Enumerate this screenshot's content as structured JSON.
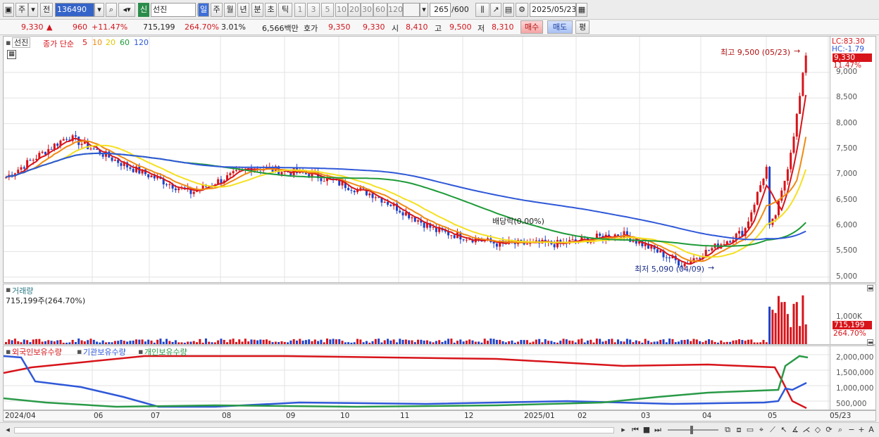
{
  "toolbar": {
    "mode_main": "주",
    "mode_prev": "전",
    "stock_code": "136490",
    "stock_badge": "신",
    "stock_name": "선진",
    "period_tabs": [
      "일",
      "주",
      "월",
      "년",
      "분",
      "초",
      "틱"
    ],
    "period_active": "일",
    "interval_buttons": [
      "1",
      "3",
      "5",
      "10",
      "20",
      "30",
      "60",
      "120"
    ],
    "count_display": "265",
    "count_total": "/600",
    "date": "2025/05/23"
  },
  "quote": {
    "price": "9,330",
    "change_arrow": "▲",
    "change": "960",
    "change_pct": "+11.47%",
    "volume": "715,199",
    "volume_ratio": "264.70%",
    "turnover": "3.01%",
    "amount": "6,566백만",
    "bid_label": "호가",
    "ask": "9,350",
    "bid": "9,330",
    "open_label": "시",
    "open": "8,410",
    "high_label": "고",
    "high": "9,500",
    "low_label": "저",
    "low": "8,310",
    "buy_button": "매수",
    "sell_button": "매도",
    "eval_button": "평"
  },
  "price_panel": {
    "title": "선진",
    "legend_title": "종가 단순",
    "ma_labels": [
      "5",
      "10",
      "20",
      "60",
      "120"
    ],
    "ma_colors": [
      "#d7141a",
      "#f08a12",
      "#f5e020",
      "#1e9a38",
      "#2f58d8"
    ],
    "annotation_high": "최고 9,500 (05/23)",
    "annotation_low": "최저 5,090 (04/09)",
    "annotation_div": "배당락(0.00%)",
    "axis_top": "LC:83.30",
    "axis_hc": "HC:-1.79",
    "price_tag": "9,330",
    "pct_tag": "11.47%",
    "y_ticks": [
      "9,000",
      "8,500",
      "8,000",
      "7,500",
      "7,000",
      "6,500",
      "6,000",
      "5,500",
      "5,000"
    ]
  },
  "volume_panel": {
    "title": "거래량",
    "subtitle": "715,199주(264.70%)",
    "axis_tick": "1,000K",
    "value_tag": "715,199",
    "pct_tag": "264.70%"
  },
  "holder_panel": {
    "foreign_label": "외국인보유수량",
    "inst_label": "기관보유수량",
    "indiv_label": "개인보유수량",
    "colors": {
      "foreign": "#d7141a",
      "inst": "#2f58d8",
      "indiv": "#2a9a48"
    },
    "y_ticks": [
      "2,000,000",
      "1,500,000",
      "1,000,000",
      "500,000"
    ]
  },
  "x_axis": {
    "labels": [
      "2024/04",
      "06",
      "07",
      "08",
      "09",
      "10",
      "11",
      "12",
      "2025/01",
      "02",
      "03",
      "04",
      "05",
      "05/23"
    ]
  },
  "chart_data": {
    "type": "candlestick",
    "title": "선진",
    "high": {
      "value": 9500,
      "date": "05/23"
    },
    "low": {
      "value": 5090,
      "date": "04/09"
    },
    "last_close": 9330,
    "ylim": [
      4900,
      9700
    ],
    "monthly_close_estimate": {
      "x": [
        "2024/04",
        "06",
        "07",
        "08",
        "09",
        "10",
        "11",
        "12",
        "2025/01",
        "02",
        "03",
        "04",
        "05",
        "05/23"
      ],
      "values": [
        6950,
        7750,
        7150,
        6650,
        7150,
        7000,
        6600,
        5900,
        5650,
        5650,
        5850,
        5250,
        5900,
        9330
      ]
    },
    "volume_last": 715199
  },
  "bottom_icons": [
    "prev-icon",
    "play-icon",
    "stop-icon",
    "next-icon",
    "zoom-slider",
    "settings-icon",
    "zoom-in-icon",
    "zoom-out-icon",
    "text-icon"
  ]
}
